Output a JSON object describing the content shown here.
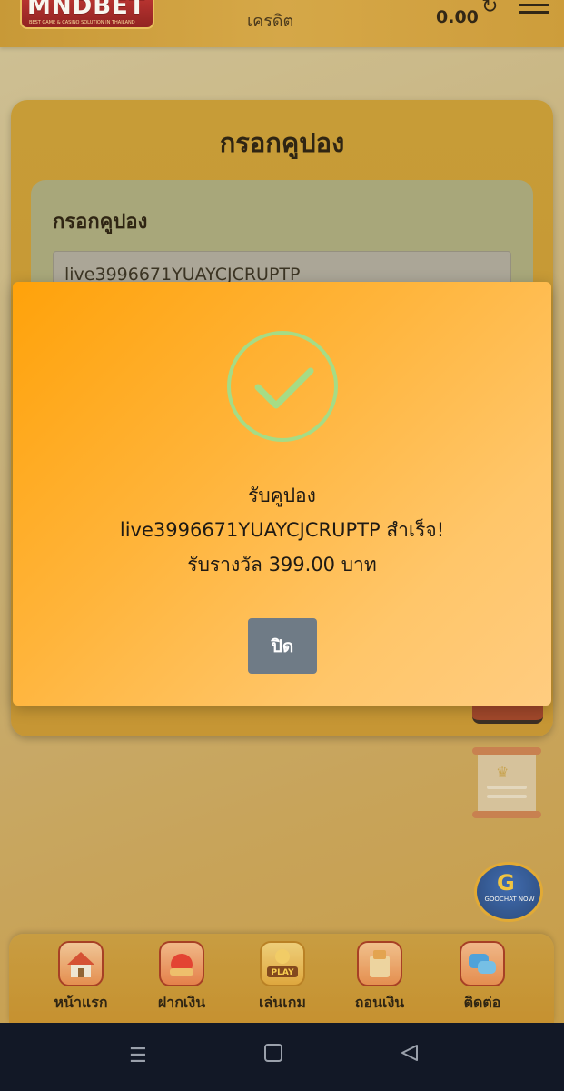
{
  "header": {
    "logo_text": "MNDBET",
    "logo_tagline": "BEST GAME & CASINO SOLUTION IN THAILAND",
    "credit_label": "เครดิต",
    "balance": "0.00"
  },
  "coupon_page": {
    "title": "กรอกคูปอง",
    "field_label": "กรอกคูปอง",
    "field_value": "live3996671YUAYCJCRUPTP"
  },
  "modal": {
    "line1": "รับคูปอง",
    "line2": "live3996671YUAYCJCRUPTP สำเร็จ!",
    "line3": "รับรางวัล 399.00 บาท",
    "close_label": "ปิด",
    "success_color": "#a5dc86"
  },
  "chat": {
    "label": "GOOCHAT NOW"
  },
  "bottom_nav": [
    {
      "label": "หน้าแรก",
      "icon": "home-icon"
    },
    {
      "label": "ฝากเงิน",
      "icon": "deposit-icon"
    },
    {
      "label": "เล่นเกม",
      "icon": "play-icon",
      "badge": "PLAY"
    },
    {
      "label": "ถอนเงิน",
      "icon": "withdraw-icon"
    },
    {
      "label": "ติดต่อ",
      "icon": "contact-icon"
    }
  ],
  "colors": {
    "accent": "#ffa20a",
    "nav_bg": "#c99a3a",
    "system_bar": "#121826"
  }
}
